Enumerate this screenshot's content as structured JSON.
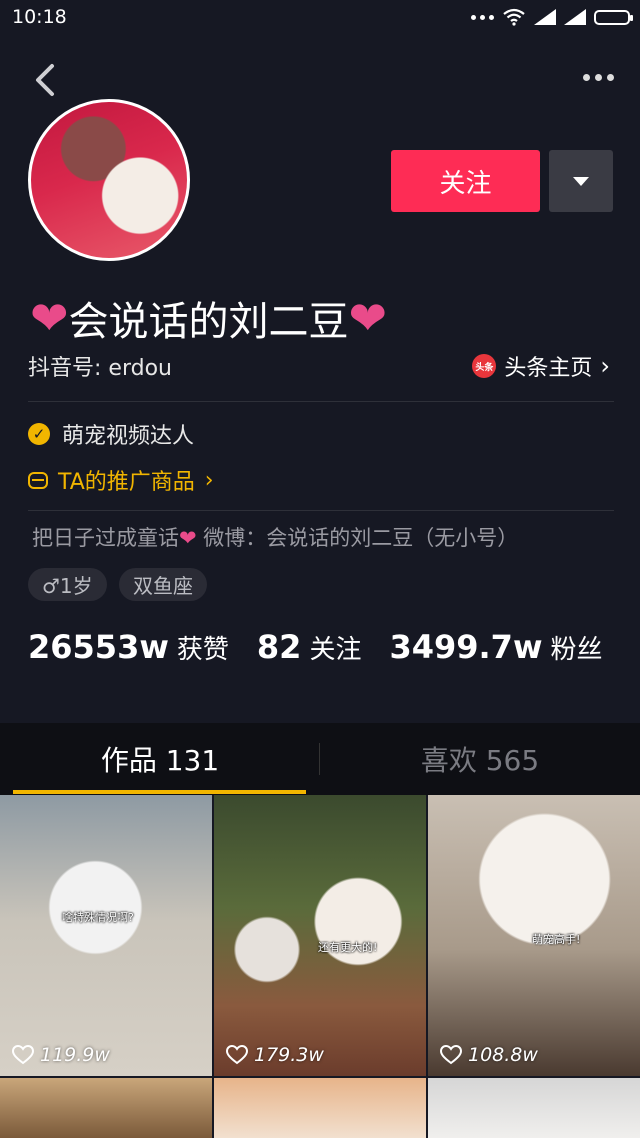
{
  "status_bar": {
    "time": "10:18"
  },
  "profile": {
    "name": "会说话的刘二豆",
    "name_heart": "❤",
    "douyin_id": "抖音号: erdou",
    "toutiao_logo": "头条",
    "toutiao_link": "头条主页",
    "follow_label": "关注",
    "verified_label": "萌宠视频达人",
    "promo_label": "TA的推广商品",
    "bio_before": "把日子过成童话",
    "bio_after": " 微博：会说话的刘二豆（无小号）",
    "tag_age": "♂1岁",
    "tag_zodiac": "双鱼座"
  },
  "stats": {
    "likes_value": "26553w",
    "likes_label": "获赞",
    "following_value": "82",
    "following_label": "关注",
    "fans_value": "3499.7w",
    "fans_label": "粉丝"
  },
  "tabs": {
    "works": "作品 131",
    "likes": "喜欢 565"
  },
  "videos": [
    {
      "caption": "啥特殊情况啊?",
      "likes": "119.9w"
    },
    {
      "caption": "还有更大的!",
      "likes": "179.3w"
    },
    {
      "caption": "萌宠高手!",
      "likes": "108.8w"
    }
  ],
  "colors": {
    "background": "#161823",
    "accent": "#fe2c55",
    "gold": "#f1b500",
    "heart": "#e94b8a"
  }
}
